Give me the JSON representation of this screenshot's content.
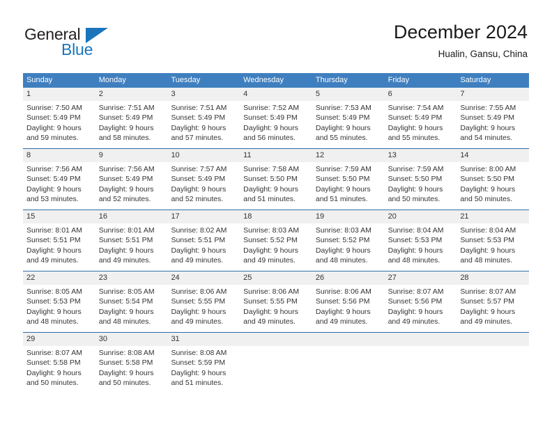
{
  "brand": {
    "name_part1": "General",
    "name_part2": "Blue",
    "triangle_icon": "blue-triangle-icon"
  },
  "header": {
    "title": "December 2024",
    "subtitle": "Hualin, Gansu, China"
  },
  "colors": {
    "header_blue": "#3f7fbf",
    "rule_blue": "#2d6ca8",
    "brand_blue": "#1b75bb",
    "daynum_band": "#f0f0f0",
    "text": "#333333"
  },
  "weekday_headers": [
    "Sunday",
    "Monday",
    "Tuesday",
    "Wednesday",
    "Thursday",
    "Friday",
    "Saturday"
  ],
  "weeks": [
    [
      {
        "day": "1",
        "sunrise": "Sunrise: 7:50 AM",
        "sunset": "Sunset: 5:49 PM",
        "daylight_line1": "Daylight: 9 hours",
        "daylight_line2": "and 59 minutes."
      },
      {
        "day": "2",
        "sunrise": "Sunrise: 7:51 AM",
        "sunset": "Sunset: 5:49 PM",
        "daylight_line1": "Daylight: 9 hours",
        "daylight_line2": "and 58 minutes."
      },
      {
        "day": "3",
        "sunrise": "Sunrise: 7:51 AM",
        "sunset": "Sunset: 5:49 PM",
        "daylight_line1": "Daylight: 9 hours",
        "daylight_line2": "and 57 minutes."
      },
      {
        "day": "4",
        "sunrise": "Sunrise: 7:52 AM",
        "sunset": "Sunset: 5:49 PM",
        "daylight_line1": "Daylight: 9 hours",
        "daylight_line2": "and 56 minutes."
      },
      {
        "day": "5",
        "sunrise": "Sunrise: 7:53 AM",
        "sunset": "Sunset: 5:49 PM",
        "daylight_line1": "Daylight: 9 hours",
        "daylight_line2": "and 55 minutes."
      },
      {
        "day": "6",
        "sunrise": "Sunrise: 7:54 AM",
        "sunset": "Sunset: 5:49 PM",
        "daylight_line1": "Daylight: 9 hours",
        "daylight_line2": "and 55 minutes."
      },
      {
        "day": "7",
        "sunrise": "Sunrise: 7:55 AM",
        "sunset": "Sunset: 5:49 PM",
        "daylight_line1": "Daylight: 9 hours",
        "daylight_line2": "and 54 minutes."
      }
    ],
    [
      {
        "day": "8",
        "sunrise": "Sunrise: 7:56 AM",
        "sunset": "Sunset: 5:49 PM",
        "daylight_line1": "Daylight: 9 hours",
        "daylight_line2": "and 53 minutes."
      },
      {
        "day": "9",
        "sunrise": "Sunrise: 7:56 AM",
        "sunset": "Sunset: 5:49 PM",
        "daylight_line1": "Daylight: 9 hours",
        "daylight_line2": "and 52 minutes."
      },
      {
        "day": "10",
        "sunrise": "Sunrise: 7:57 AM",
        "sunset": "Sunset: 5:49 PM",
        "daylight_line1": "Daylight: 9 hours",
        "daylight_line2": "and 52 minutes."
      },
      {
        "day": "11",
        "sunrise": "Sunrise: 7:58 AM",
        "sunset": "Sunset: 5:50 PM",
        "daylight_line1": "Daylight: 9 hours",
        "daylight_line2": "and 51 minutes."
      },
      {
        "day": "12",
        "sunrise": "Sunrise: 7:59 AM",
        "sunset": "Sunset: 5:50 PM",
        "daylight_line1": "Daylight: 9 hours",
        "daylight_line2": "and 51 minutes."
      },
      {
        "day": "13",
        "sunrise": "Sunrise: 7:59 AM",
        "sunset": "Sunset: 5:50 PM",
        "daylight_line1": "Daylight: 9 hours",
        "daylight_line2": "and 50 minutes."
      },
      {
        "day": "14",
        "sunrise": "Sunrise: 8:00 AM",
        "sunset": "Sunset: 5:50 PM",
        "daylight_line1": "Daylight: 9 hours",
        "daylight_line2": "and 50 minutes."
      }
    ],
    [
      {
        "day": "15",
        "sunrise": "Sunrise: 8:01 AM",
        "sunset": "Sunset: 5:51 PM",
        "daylight_line1": "Daylight: 9 hours",
        "daylight_line2": "and 49 minutes."
      },
      {
        "day": "16",
        "sunrise": "Sunrise: 8:01 AM",
        "sunset": "Sunset: 5:51 PM",
        "daylight_line1": "Daylight: 9 hours",
        "daylight_line2": "and 49 minutes."
      },
      {
        "day": "17",
        "sunrise": "Sunrise: 8:02 AM",
        "sunset": "Sunset: 5:51 PM",
        "daylight_line1": "Daylight: 9 hours",
        "daylight_line2": "and 49 minutes."
      },
      {
        "day": "18",
        "sunrise": "Sunrise: 8:03 AM",
        "sunset": "Sunset: 5:52 PM",
        "daylight_line1": "Daylight: 9 hours",
        "daylight_line2": "and 49 minutes."
      },
      {
        "day": "19",
        "sunrise": "Sunrise: 8:03 AM",
        "sunset": "Sunset: 5:52 PM",
        "daylight_line1": "Daylight: 9 hours",
        "daylight_line2": "and 48 minutes."
      },
      {
        "day": "20",
        "sunrise": "Sunrise: 8:04 AM",
        "sunset": "Sunset: 5:53 PM",
        "daylight_line1": "Daylight: 9 hours",
        "daylight_line2": "and 48 minutes."
      },
      {
        "day": "21",
        "sunrise": "Sunrise: 8:04 AM",
        "sunset": "Sunset: 5:53 PM",
        "daylight_line1": "Daylight: 9 hours",
        "daylight_line2": "and 48 minutes."
      }
    ],
    [
      {
        "day": "22",
        "sunrise": "Sunrise: 8:05 AM",
        "sunset": "Sunset: 5:53 PM",
        "daylight_line1": "Daylight: 9 hours",
        "daylight_line2": "and 48 minutes."
      },
      {
        "day": "23",
        "sunrise": "Sunrise: 8:05 AM",
        "sunset": "Sunset: 5:54 PM",
        "daylight_line1": "Daylight: 9 hours",
        "daylight_line2": "and 48 minutes."
      },
      {
        "day": "24",
        "sunrise": "Sunrise: 8:06 AM",
        "sunset": "Sunset: 5:55 PM",
        "daylight_line1": "Daylight: 9 hours",
        "daylight_line2": "and 49 minutes."
      },
      {
        "day": "25",
        "sunrise": "Sunrise: 8:06 AM",
        "sunset": "Sunset: 5:55 PM",
        "daylight_line1": "Daylight: 9 hours",
        "daylight_line2": "and 49 minutes."
      },
      {
        "day": "26",
        "sunrise": "Sunrise: 8:06 AM",
        "sunset": "Sunset: 5:56 PM",
        "daylight_line1": "Daylight: 9 hours",
        "daylight_line2": "and 49 minutes."
      },
      {
        "day": "27",
        "sunrise": "Sunrise: 8:07 AM",
        "sunset": "Sunset: 5:56 PM",
        "daylight_line1": "Daylight: 9 hours",
        "daylight_line2": "and 49 minutes."
      },
      {
        "day": "28",
        "sunrise": "Sunrise: 8:07 AM",
        "sunset": "Sunset: 5:57 PM",
        "daylight_line1": "Daylight: 9 hours",
        "daylight_line2": "and 49 minutes."
      }
    ],
    [
      {
        "day": "29",
        "sunrise": "Sunrise: 8:07 AM",
        "sunset": "Sunset: 5:58 PM",
        "daylight_line1": "Daylight: 9 hours",
        "daylight_line2": "and 50 minutes."
      },
      {
        "day": "30",
        "sunrise": "Sunrise: 8:08 AM",
        "sunset": "Sunset: 5:58 PM",
        "daylight_line1": "Daylight: 9 hours",
        "daylight_line2": "and 50 minutes."
      },
      {
        "day": "31",
        "sunrise": "Sunrise: 8:08 AM",
        "sunset": "Sunset: 5:59 PM",
        "daylight_line1": "Daylight: 9 hours",
        "daylight_line2": "and 51 minutes."
      },
      {
        "day": "",
        "sunrise": "",
        "sunset": "",
        "daylight_line1": "",
        "daylight_line2": ""
      },
      {
        "day": "",
        "sunrise": "",
        "sunset": "",
        "daylight_line1": "",
        "daylight_line2": ""
      },
      {
        "day": "",
        "sunrise": "",
        "sunset": "",
        "daylight_line1": "",
        "daylight_line2": ""
      },
      {
        "day": "",
        "sunrise": "",
        "sunset": "",
        "daylight_line1": "",
        "daylight_line2": ""
      }
    ]
  ]
}
